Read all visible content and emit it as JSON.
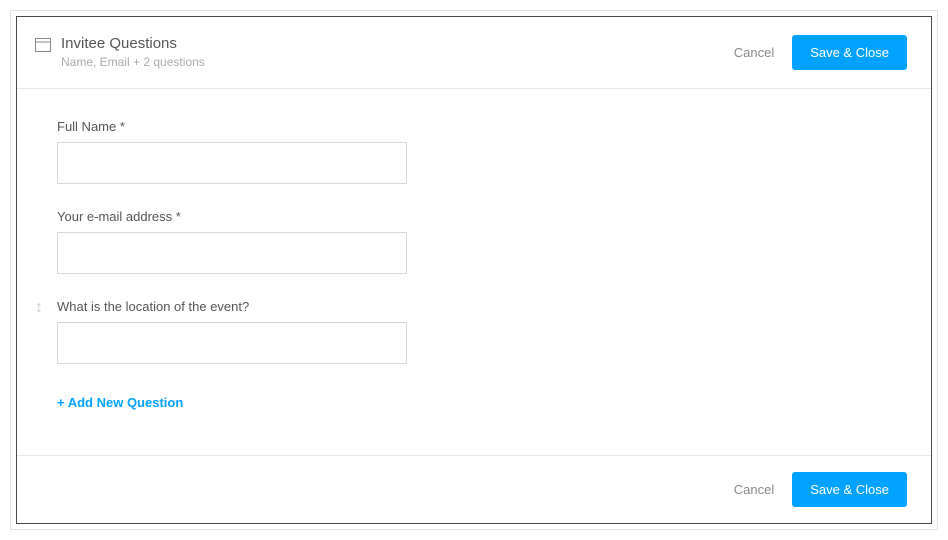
{
  "header": {
    "title": "Invitee Questions",
    "subtitle": "Name, Email + 2 questions",
    "cancel_label": "Cancel",
    "save_label": "Save & Close"
  },
  "questions": [
    {
      "label": "Full Name *",
      "draggable": false
    },
    {
      "label": "Your e-mail address *",
      "draggable": false
    },
    {
      "label": "What is the location of the event?",
      "draggable": true
    }
  ],
  "add_question_label": "+ Add New Question",
  "footer": {
    "cancel_label": "Cancel",
    "save_label": "Save & Close"
  }
}
